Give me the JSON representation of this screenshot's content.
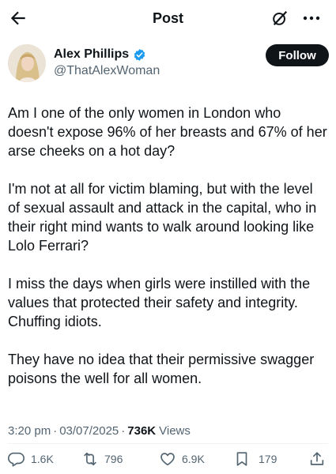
{
  "header": {
    "title": "Post"
  },
  "author": {
    "name": "Alex Phillips",
    "handle": "@ThatAlexWoman",
    "verified": true,
    "follow_label": "Follow"
  },
  "post": {
    "paragraphs": [
      "Am I one of the only women in London who doesn't expose 96% of her breasts and 67% of her arse cheeks on a hot day?",
      "I'm not at all for victim blaming, but with the level of sexual assault and attack in the capital, who in their right mind wants to walk around looking like Lolo Ferrari?",
      "I miss the days when girls were instilled with the values that protected their safety and integrity. Chuffing idiots.",
      "They have no idea that their permissive swagger poisons the well for all women."
    ],
    "time": "3:20 pm",
    "date": "03/07/2025",
    "views": "736K",
    "views_label": "Views"
  },
  "actions": {
    "replies": "1.6K",
    "reposts": "796",
    "likes": "6.9K",
    "bookmarks": "179"
  },
  "colors": {
    "text": "#0f1419",
    "secondary": "#536471",
    "verified": "#1d9bf0"
  }
}
